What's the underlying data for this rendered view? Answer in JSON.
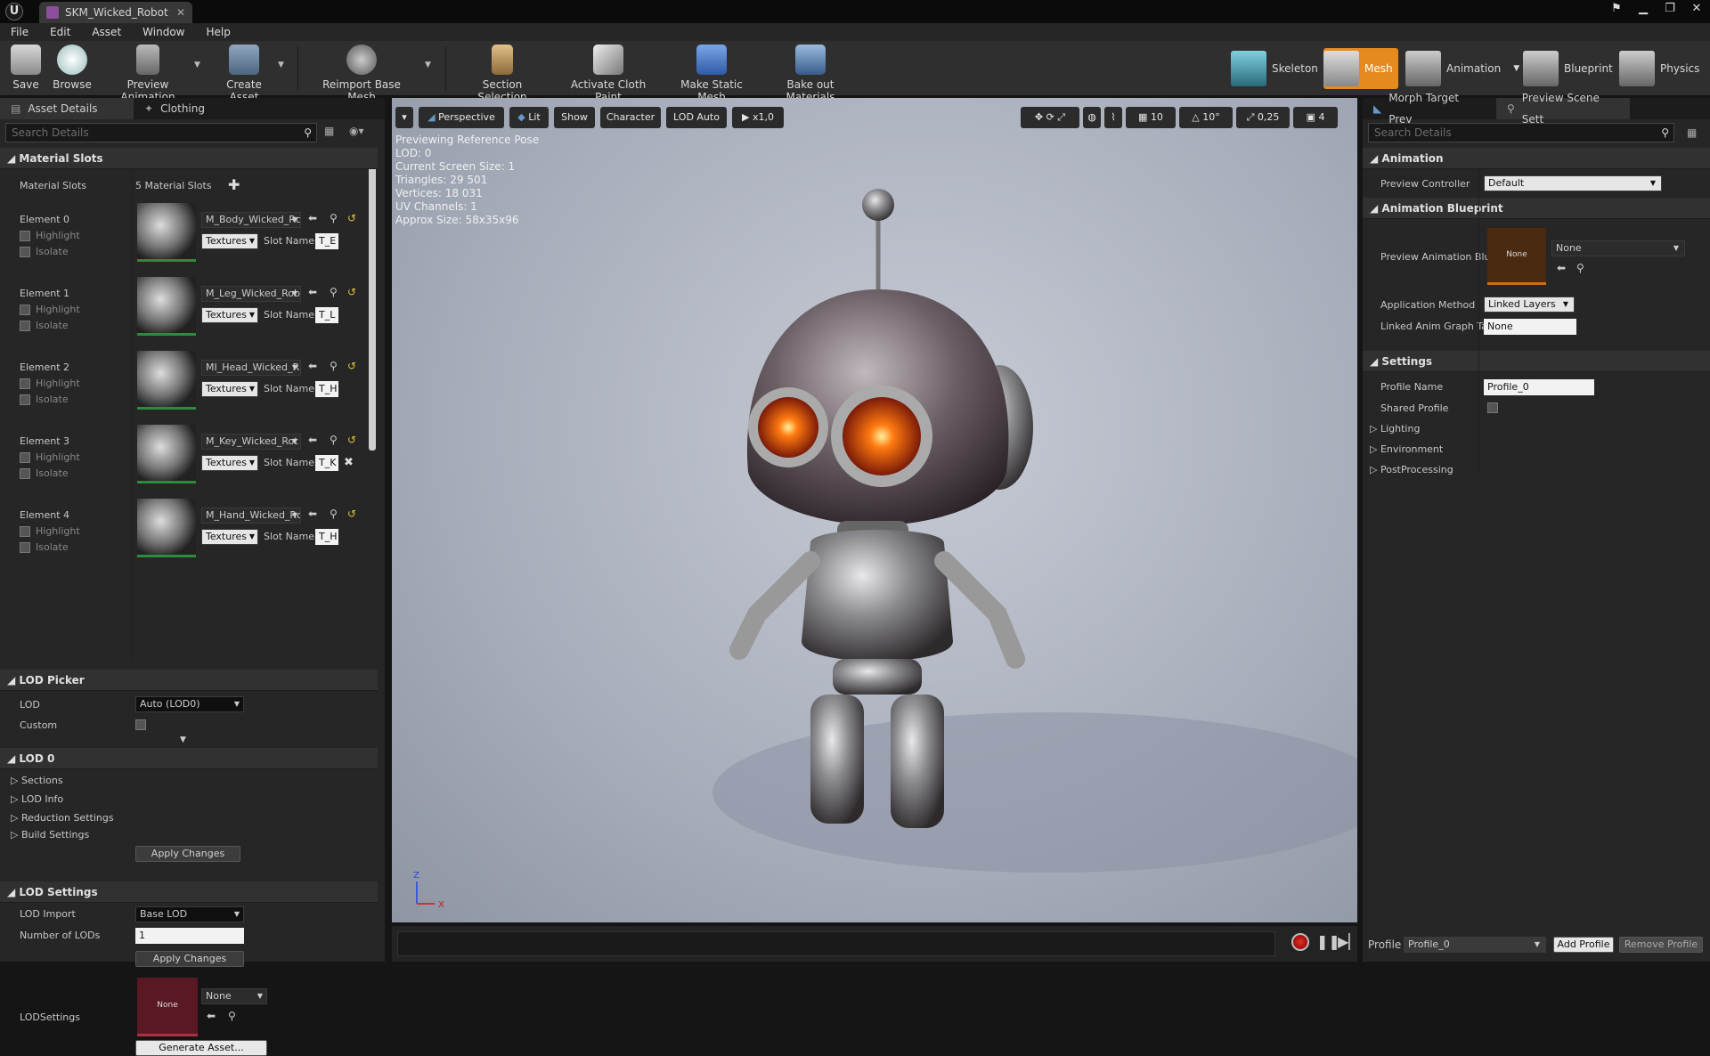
{
  "window": {
    "tab_title": "SKM_Wicked_Robot"
  },
  "menu": [
    "File",
    "Edit",
    "Asset",
    "Window",
    "Help"
  ],
  "toolbar": {
    "save": "Save",
    "browse": "Browse",
    "preview_animation": "Preview Animation",
    "create_asset": "Create Asset",
    "reimport": "Reimport Base Mesh",
    "section_selection": "Section Selection",
    "activate_cloth": "Activate Cloth Paint",
    "make_static": "Make Static Mesh",
    "bake_out": "Bake out Materials"
  },
  "modes": {
    "skeleton": "Skeleton",
    "mesh": "Mesh",
    "animation": "Animation",
    "blueprint": "Blueprint",
    "physics": "Physics"
  },
  "left_panel": {
    "tabs": [
      "Asset Details",
      "Clothing"
    ],
    "search_placeholder": "Search Details",
    "material_slots": {
      "header": "Material Slots",
      "label": "Material Slots",
      "count": "5 Material Slots",
      "elements": [
        {
          "name": "Element 0",
          "material": "M_Body_Wicked_Rc",
          "slot": "T_E"
        },
        {
          "name": "Element 1",
          "material": "M_Leg_Wicked_Rob",
          "slot": "T_L"
        },
        {
          "name": "Element 2",
          "material": "MI_Head_Wicked_R",
          "slot": "T_H"
        },
        {
          "name": "Element 3",
          "material": "M_Key_Wicked_Rot",
          "slot": "T_K"
        },
        {
          "name": "Element 4",
          "material": "M_Hand_Wicked_Rc",
          "slot": "T_H"
        }
      ],
      "highlight": "Highlight",
      "isolate": "Isolate",
      "textures": "Textures",
      "slot_name": "Slot Name"
    },
    "lod_picker": {
      "header": "LOD Picker",
      "lod_label": "LOD",
      "lod_value": "Auto (LOD0)",
      "custom_label": "Custom"
    },
    "lod0": {
      "header": "LOD 0",
      "items": [
        "Sections",
        "LOD Info",
        "Reduction Settings",
        "Build Settings"
      ],
      "apply": "Apply Changes"
    },
    "lod_settings": {
      "header": "LOD Settings",
      "import_label": "LOD Import",
      "import_value": "Base LOD",
      "num_label": "Number of LODs",
      "num_value": "1",
      "apply": "Apply Changes",
      "lodsettings_label": "LODSettings",
      "none": "None",
      "generate": "Generate Asset..."
    }
  },
  "viewport": {
    "perspective": "Perspective",
    "lit": "Lit",
    "show": "Show",
    "character": "Character",
    "lod_auto": "LOD Auto",
    "speed": "x1,0",
    "grid": "10",
    "angle": "10°",
    "scale": "0,25",
    "cam_speed": "4",
    "stats": [
      "Previewing Reference Pose",
      "LOD: 0",
      "Current Screen Size: 1",
      "Triangles: 29 501",
      "Vertices: 18 031",
      "UV Channels: 1",
      "Approx Size: 58x35x96"
    ]
  },
  "right_panel": {
    "tabs": [
      "Morph Target Prev",
      "Preview Scene Sett"
    ],
    "search_placeholder": "Search Details",
    "animation": {
      "header": "Animation",
      "preview_controller_label": "Preview Controller",
      "preview_controller_value": "Default"
    },
    "anim_bp": {
      "header": "Animation Blueprint",
      "preview_label": "Preview Animation Blu",
      "thumb_text": "None",
      "combo_value": "None",
      "app_method_label": "Application Method",
      "app_method_value": "Linked Layers",
      "linked_label": "Linked Anim Graph Ta",
      "linked_value": "None"
    },
    "settings": {
      "header": "Settings",
      "profile_name_label": "Profile Name",
      "profile_name_value": "Profile_0",
      "shared_label": "Shared Profile",
      "subs": [
        "Lighting",
        "Environment",
        "PostProcessing"
      ]
    },
    "footer": {
      "profile_label": "Profile",
      "profile_value": "Profile_0",
      "add": "Add Profile",
      "remove": "Remove Profile"
    }
  },
  "colors": {
    "mesh_mode_active": "#e58a1f",
    "thumb_border": "#2e8b3e",
    "lodsettings_thumb": "#5a1822",
    "anim_bp_thumb": "#4a2a10"
  }
}
